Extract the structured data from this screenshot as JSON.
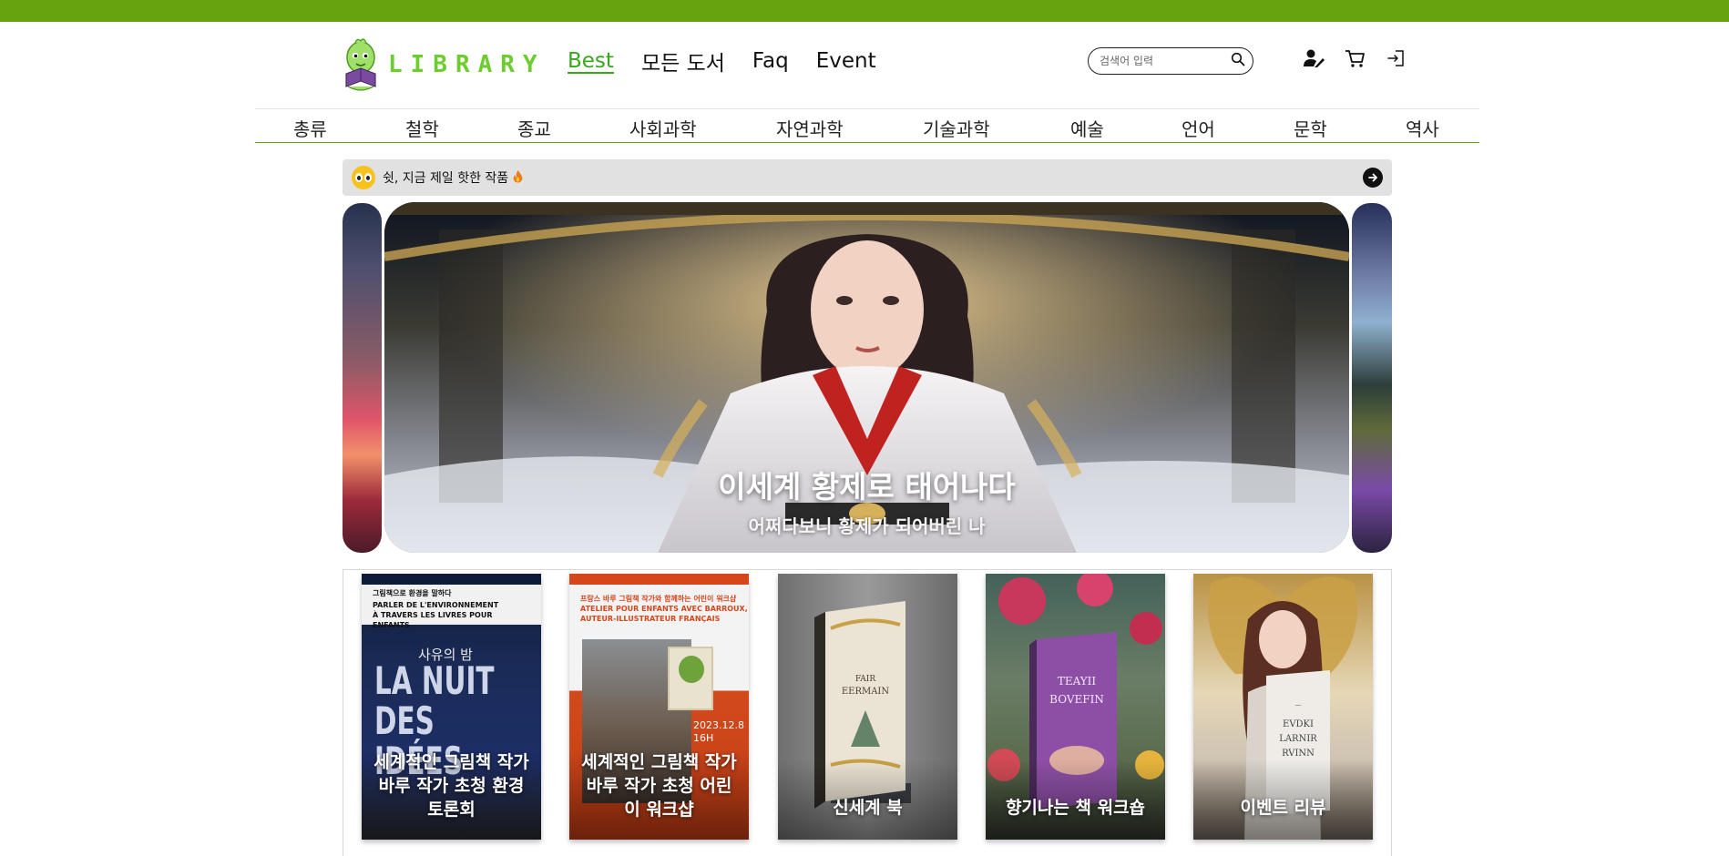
{
  "header": {
    "logo_text": "LIBRARY",
    "nav": [
      {
        "label": "Best",
        "active": true
      },
      {
        "label": "모든 도서",
        "active": false
      },
      {
        "label": "Faq",
        "active": false
      },
      {
        "label": "Event",
        "active": false
      }
    ],
    "search": {
      "placeholder": "검색어 입력"
    },
    "icons": [
      "user-edit-icon",
      "cart-icon",
      "login-icon"
    ]
  },
  "categories": [
    "총류",
    "철학",
    "종교",
    "사회과학",
    "자연과학",
    "기술과학",
    "예술",
    "언어",
    "문학",
    "역사"
  ],
  "hot": {
    "text": "쉿, 지금 제일 핫한 작품",
    "icon": "eyes-icon",
    "fire_icon": "fire-icon",
    "arrow_icon": "arrow-right-icon"
  },
  "hero": {
    "title": "이세계 황제로 태어나다",
    "subtitle": "어쩌다보니 황제가 되어버린 나"
  },
  "events": [
    {
      "label": "세계적인 그림책 작가 바루 작가 초청 환경 토론회",
      "poster_header": [
        "그림책으로 환경을 말하다",
        "PARLER DE L'ENVIRONNEMENT",
        "À TRAVERS LES LIVRES POUR ENFANTS"
      ],
      "poster_small": "사유의 밤",
      "poster_big": [
        "LA NUIT",
        "DES IDÉES"
      ]
    },
    {
      "label": "세계적인 그림책 작가 바루 작가 초청 어린이 워크샵",
      "poster_header": [
        "프랑스 바루 그림책 작가와 함께하는 어린이 워크샵",
        "ATELIER POUR ENFANTS AVEC BARROUX,",
        "AUTEUR-ILLUSTRATEUR FRANÇAIS"
      ],
      "poster_date": [
        "2023.12.8",
        "16H"
      ]
    },
    {
      "label": "신세계 북",
      "book_title": [
        "FAIR",
        "EERMAIN"
      ]
    },
    {
      "label": "향기나는 책 워크숍",
      "book_title": [
        "TEAYII",
        "BOVEFIN"
      ]
    },
    {
      "label": "이벤트 리뷰",
      "book_title": [
        "EVDKI",
        "LARNIR",
        "RVINN"
      ]
    }
  ],
  "colors": {
    "brand": "#67a30f",
    "logo": "#6ccd2e",
    "nav_active": "#3aa61e"
  }
}
